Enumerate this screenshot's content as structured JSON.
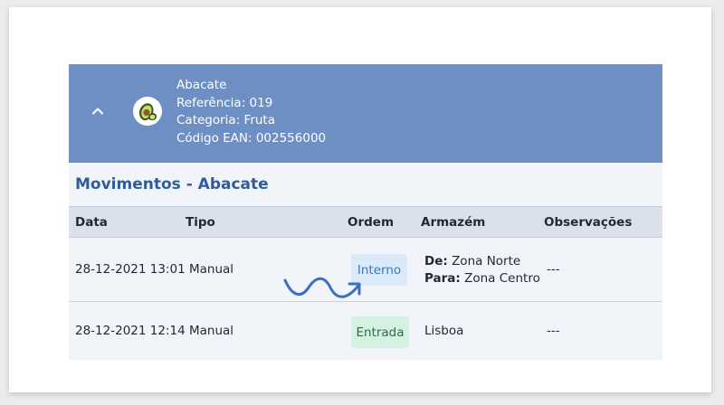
{
  "product": {
    "name": "Abacate",
    "reference": "Referência: 019",
    "category": "Categoria: Fruta",
    "ean": "Código EAN: 002556000"
  },
  "section_title": "Movimentos - Abacate",
  "table": {
    "headers": [
      "Data",
      "Tipo",
      "Ordem",
      "Armazém",
      "Observações"
    ],
    "rows": [
      {
        "date": "28-12-2021 13:01",
        "type": "Manual",
        "order": "Interno",
        "from_label": "De:",
        "from_value": "Zona Norte",
        "to_label": "Para:",
        "to_value": "Zona Centro",
        "notes": "---"
      },
      {
        "date": "28-12-2021 12:14",
        "type": "Manual",
        "order": "Entrada",
        "warehouse": "Lisboa",
        "notes": "---"
      }
    ]
  },
  "colors": {
    "header_bg": "#6e8fc4",
    "title": "#2f5d9c",
    "badge_internal_bg": "#dbeaf8",
    "badge_entry_bg": "#d4f1e2",
    "annotation_arrow": "#3a6fc2"
  },
  "icons": {
    "collapse": "chevron-up-icon",
    "product": "avocado-icon",
    "annotation": "curved-arrow-icon"
  }
}
